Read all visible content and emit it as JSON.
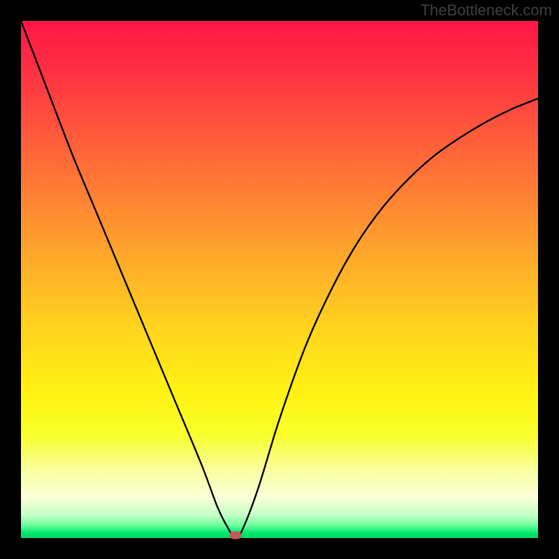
{
  "watermark": "TheBottleneck.com",
  "chart_data": {
    "type": "line",
    "title": "",
    "xlabel": "",
    "ylabel": "",
    "xlim": [
      0,
      100
    ],
    "ylim": [
      0,
      100
    ],
    "x": [
      0,
      5,
      10,
      15,
      20,
      25,
      30,
      35,
      38,
      40,
      41.5,
      43,
      46,
      50,
      55,
      60,
      65,
      70,
      75,
      80,
      85,
      90,
      95,
      100
    ],
    "values": [
      100,
      87,
      74,
      62,
      50,
      38,
      26,
      14,
      6,
      2,
      0,
      2,
      10,
      23,
      37,
      48,
      57,
      64,
      69.5,
      74,
      77.5,
      80.5,
      83,
      85
    ],
    "min_point": {
      "x": 41.5,
      "y": 0
    },
    "gradient_stops": [
      {
        "pos": 0.0,
        "color": "#ff1647"
      },
      {
        "pos": 0.1,
        "color": "#ff3142"
      },
      {
        "pos": 0.22,
        "color": "#ff5a3b"
      },
      {
        "pos": 0.35,
        "color": "#ff8533"
      },
      {
        "pos": 0.48,
        "color": "#ffb028"
      },
      {
        "pos": 0.6,
        "color": "#ffd51d"
      },
      {
        "pos": 0.72,
        "color": "#fff312"
      },
      {
        "pos": 0.8,
        "color": "#f8ff2a"
      },
      {
        "pos": 0.87,
        "color": "#f8ffa0"
      },
      {
        "pos": 0.92,
        "color": "#fbffd8"
      },
      {
        "pos": 0.955,
        "color": "#c8ffc8"
      },
      {
        "pos": 0.975,
        "color": "#6fff9c"
      },
      {
        "pos": 0.99,
        "color": "#00e86e"
      },
      {
        "pos": 1.0,
        "color": "#00d862"
      }
    ]
  }
}
